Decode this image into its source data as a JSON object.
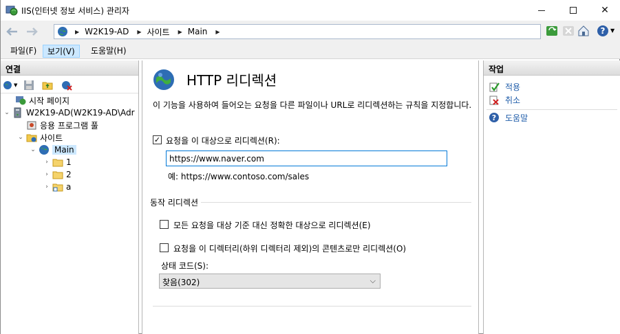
{
  "window": {
    "title": "IIS(인터넷 정보 서비스) 관리자"
  },
  "address": {
    "crumbs": [
      "W2K19-AD",
      "사이트",
      "Main"
    ]
  },
  "menu": {
    "items": [
      "파일(F)",
      "보기(V)",
      "도움말(H)"
    ]
  },
  "left_panel": {
    "header": "연결",
    "tree": {
      "start_page": "시작 페이지",
      "server": "W2K19-AD(W2K19-AD\\Adr",
      "app_pools": "응용 프로그램 풀",
      "sites": "사이트",
      "main": "Main",
      "folders": [
        "1",
        "2",
        "a"
      ]
    }
  },
  "center": {
    "title": "HTTP 리디렉션",
    "description": "이 기능을 사용하여 들어오는 요청을 다른 파일이나 URL로 리디렉션하는 규칙을 지정합니다.",
    "redirect_checkbox_label": "요청을 이 대상으로 리디렉션(R):",
    "redirect_checked": true,
    "redirect_url": "https://www.naver.com",
    "example": "예: https://www.contoso.com/sales",
    "group_legend": "동작 리디렉션",
    "option_exact_label": "모든 요청을 대상 기준 대신 정확한 대상으로 리디렉션(E)",
    "option_exact_checked": false,
    "option_dir_label": "요청을 이 디렉터리(하위 디렉터리 제외)의 콘텐츠로만 리디렉션(O)",
    "option_dir_checked": false,
    "status_code_label": "상태 코드(S):",
    "status_code_value": "찾음(302)"
  },
  "right_panel": {
    "header": "작업",
    "actions": [
      "적용",
      "취소",
      "도움말"
    ]
  },
  "colors": {
    "accent": "#0078d7",
    "link": "#1f5ca9",
    "selection": "#cce8ff"
  }
}
